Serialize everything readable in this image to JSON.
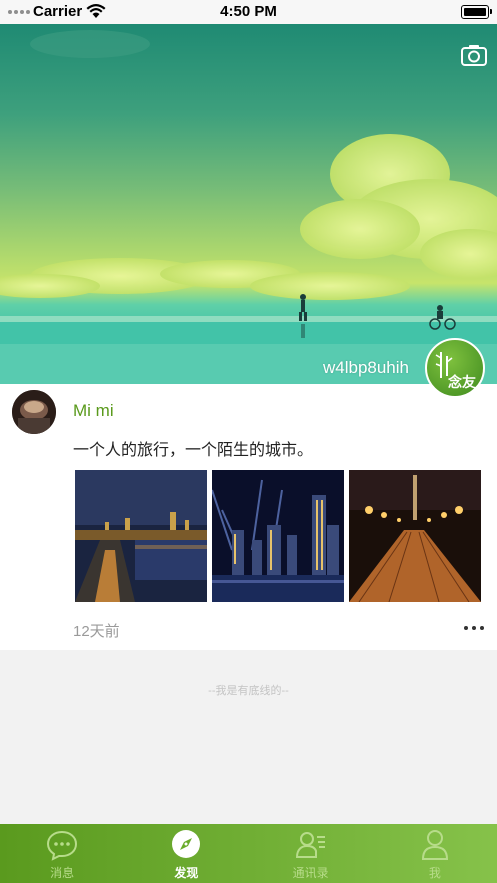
{
  "status_bar": {
    "carrier": "Carrier",
    "time": "4:50 PM"
  },
  "cover": {
    "name": "w4lbp8uhih",
    "logo_text": "念友"
  },
  "post": {
    "author": "Mi mi",
    "text": "一个人的旅行，一个陌生的城市。",
    "time": "12天前",
    "photos": [
      "night-city-moscow",
      "night-city-skyline-lasers",
      "night-pier-lamps"
    ]
  },
  "footer": {
    "text": "--我是有底线的--"
  },
  "tabs": [
    {
      "label": "消息",
      "icon": "chat-bubble-icon",
      "active": false
    },
    {
      "label": "发现",
      "icon": "compass-icon",
      "active": true
    },
    {
      "label": "通讯录",
      "icon": "contacts-icon",
      "active": false
    },
    {
      "label": "我",
      "icon": "person-icon",
      "active": false
    }
  ],
  "colors": {
    "accent": "#5a9a1c",
    "tab_bar_start": "#5a9a1e",
    "tab_bar_end": "#86c24a"
  }
}
